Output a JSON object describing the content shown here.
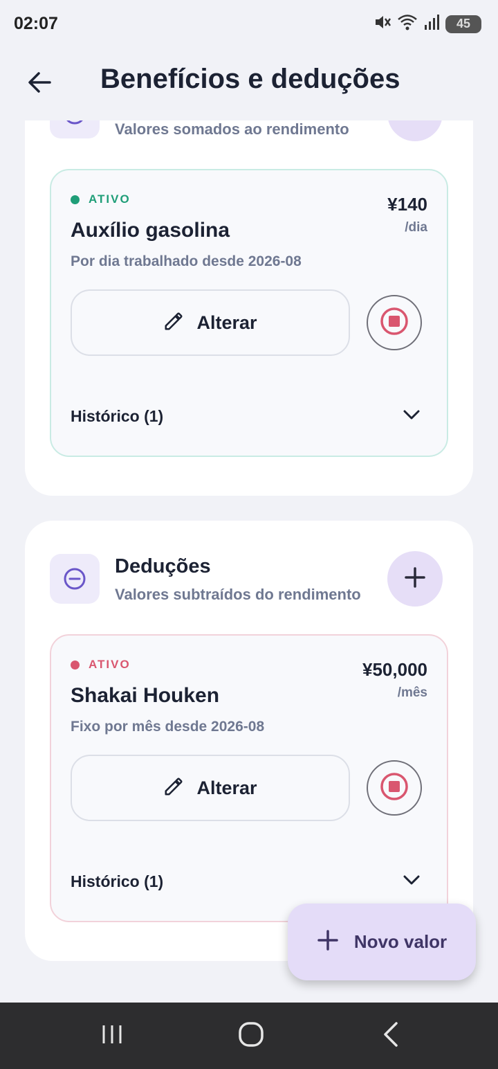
{
  "status_bar": {
    "time": "02:07",
    "battery": "45"
  },
  "header": {
    "title": "Benefícios e deduções"
  },
  "benefits": {
    "subtitle": "Valores somados ao rendimento",
    "card": {
      "status": "ATIVO",
      "status_color": "#1f9e78",
      "name": "Auxílio gasolina",
      "amount": "¥140",
      "unit": "/dia",
      "description": "Por dia trabalhado desde 2026-08",
      "edit_label": "Alterar",
      "history_label": "Histórico (1)"
    }
  },
  "deductions": {
    "title": "Deduções",
    "subtitle": "Valores subtraídos do rendimento",
    "card": {
      "status": "ATIVO",
      "status_color": "#d9566f",
      "name": "Shakai Houken",
      "amount": "¥50,000",
      "unit": "/mês",
      "description": "Fixo por mês desde 2026-08",
      "edit_label": "Alterar",
      "history_label": "Histórico (1)"
    }
  },
  "fab": {
    "label": "Novo valor"
  },
  "colors": {
    "accent": "#6a56c9",
    "stop_red": "#d9566f",
    "fab_bg": "#e4dcf8"
  },
  "icons": [
    "back-arrow-icon",
    "minus-circle-icon",
    "plus-icon",
    "pencil-icon",
    "stop-icon",
    "chevron-down-icon",
    "recents-icon",
    "home-icon",
    "nav-back-icon"
  ]
}
